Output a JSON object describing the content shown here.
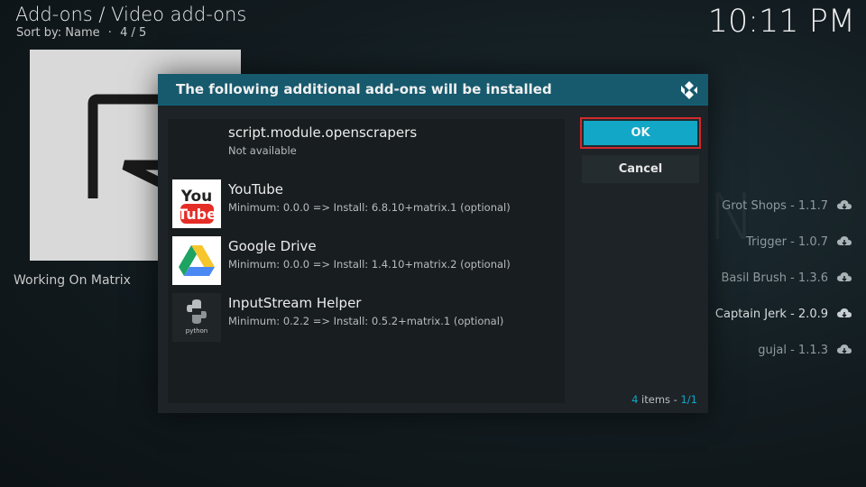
{
  "header": {
    "title": "Add-ons / Video add-ons",
    "sort_label": "Sort by: Name",
    "position": "4 / 5",
    "clock": "10:11 PM"
  },
  "left_pane": {
    "caption": "Working On Matrix"
  },
  "right_list": [
    {
      "label": "Grot Shops - 1.1.7",
      "icon": "cloud-download-icon"
    },
    {
      "label": "Trigger - 1.0.7",
      "icon": "cloud-download-icon"
    },
    {
      "label": "Basil Brush - 1.3.6",
      "icon": "cloud-download-icon"
    },
    {
      "label": "Captain Jerk - 2.0.9",
      "icon": "cloud-download-icon"
    },
    {
      "label": "gujal - 1.1.3",
      "icon": "cloud-download-icon"
    }
  ],
  "dialog": {
    "title": "The following additional add-ons will be installed",
    "ok_label": "OK",
    "cancel_label": "Cancel",
    "items": [
      {
        "name": "script.module.openscrapers",
        "detail": "Not available",
        "icon": "blank-icon"
      },
      {
        "name": "YouTube",
        "detail": "Minimum: 0.0.0 => Install: 6.8.10+matrix.1 (optional)",
        "icon": "youtube-icon"
      },
      {
        "name": "Google Drive",
        "detail": "Minimum: 0.0.0 => Install: 1.4.10+matrix.2 (optional)",
        "icon": "google-drive-icon"
      },
      {
        "name": "InputStream Helper",
        "detail": "Minimum: 0.2.2 => Install: 0.5.2+matrix.1 (optional)",
        "icon": "python-icon"
      }
    ],
    "count_num": "4",
    "count_text": " items - ",
    "page": "1/1"
  },
  "colors": {
    "accent": "#12a7c6",
    "header_bar": "#17596d",
    "focus_outline": "#d12a2e"
  }
}
